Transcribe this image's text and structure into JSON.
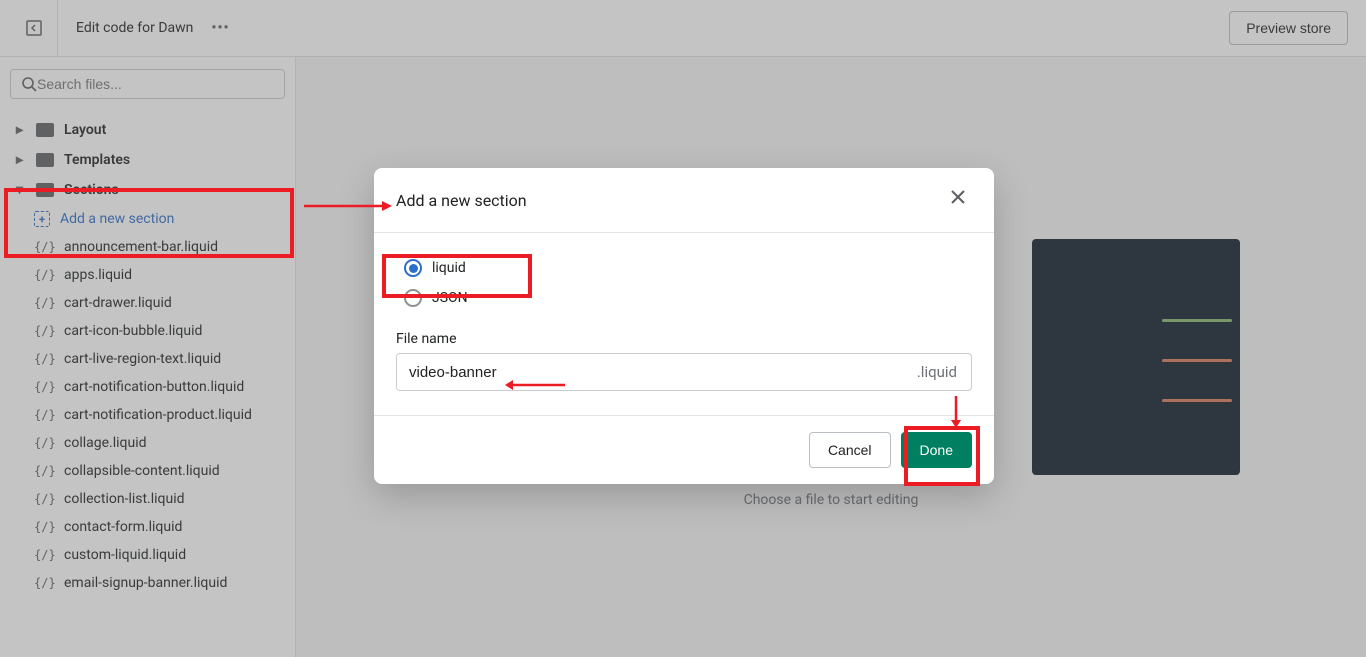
{
  "header": {
    "title": "Edit code for Dawn",
    "preview_label": "Preview store"
  },
  "sidebar": {
    "search_placeholder": "Search files...",
    "folders": {
      "layout": "Layout",
      "templates": "Templates",
      "sections": "Sections"
    },
    "add_section_label": "Add a new section",
    "files": [
      "announcement-bar.liquid",
      "apps.liquid",
      "cart-drawer.liquid",
      "cart-icon-bubble.liquid",
      "cart-live-region-text.liquid",
      "cart-notification-button.liquid",
      "cart-notification-product.liquid",
      "collage.liquid",
      "collapsible-content.liquid",
      "collection-list.liquid",
      "contact-form.liquid",
      "custom-liquid.liquid",
      "email-signup-banner.liquid"
    ]
  },
  "content": {
    "empty_text": "Choose a file to start editing"
  },
  "modal": {
    "title": "Add a new section",
    "option_liquid": "liquid",
    "option_json": "JSON",
    "filename_label": "File name",
    "filename_value": "video-banner",
    "filename_ext": ".liquid",
    "cancel_label": "Cancel",
    "done_label": "Done"
  }
}
